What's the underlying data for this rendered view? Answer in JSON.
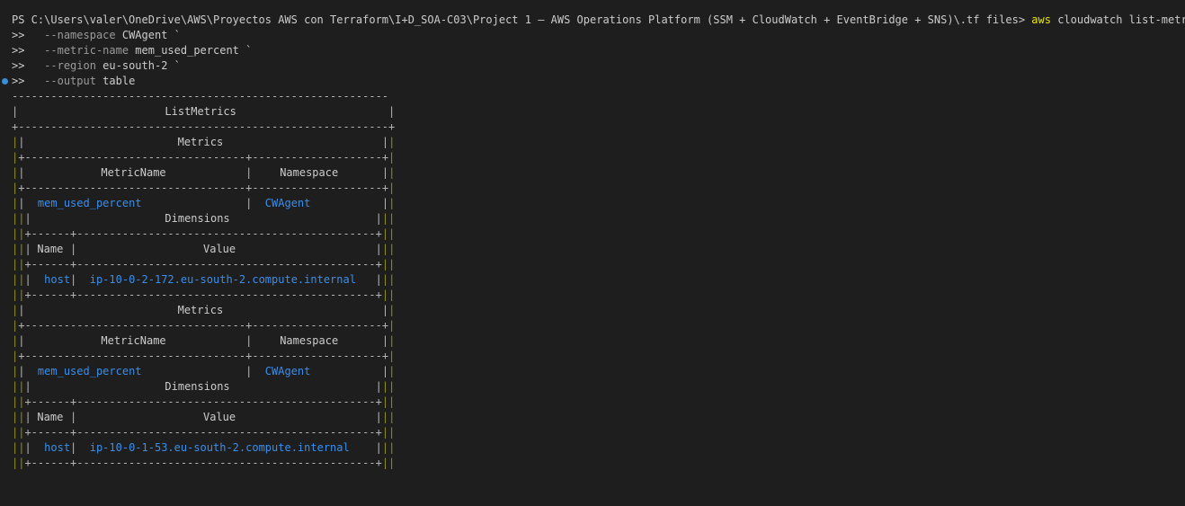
{
  "terminal": {
    "prompt": "PS C:\\Users\\valer\\OneDrive\\AWS\\Proyectos AWS con Terraform\\I+D_SOA-C03\\Project 1 — AWS Operations Platform (SSM + CloudWatch + EventBridge + SNS)\\.tf files>",
    "command": "aws",
    "command_args": "cloudwatch list-metrics `",
    "continuation_prompt": ">>",
    "params": [
      {
        "flag": "--namespace",
        "value": "CWAgent `"
      },
      {
        "flag": "--metric-name",
        "value": "mem_used_percent `"
      },
      {
        "flag": "--region",
        "value": "eu-south-2 `"
      },
      {
        "flag": "--output",
        "value": "table"
      }
    ]
  },
  "table": {
    "title": "ListMetrics",
    "metrics_header": "Metrics",
    "col_metricname": "MetricName",
    "col_namespace": "Namespace",
    "dimensions_header": "Dimensions",
    "col_name": "Name",
    "col_value": "Value",
    "rows": [
      {
        "metric_name": "mem_used_percent",
        "namespace": "CWAgent",
        "dim_name": "host",
        "dim_value": "ip-10-0-2-172.eu-south-2.compute.internal"
      },
      {
        "metric_name": "mem_used_percent",
        "namespace": "CWAgent",
        "dim_name": "host",
        "dim_value": "ip-10-0-1-53.eu-south-2.compute.internal"
      }
    ]
  }
}
